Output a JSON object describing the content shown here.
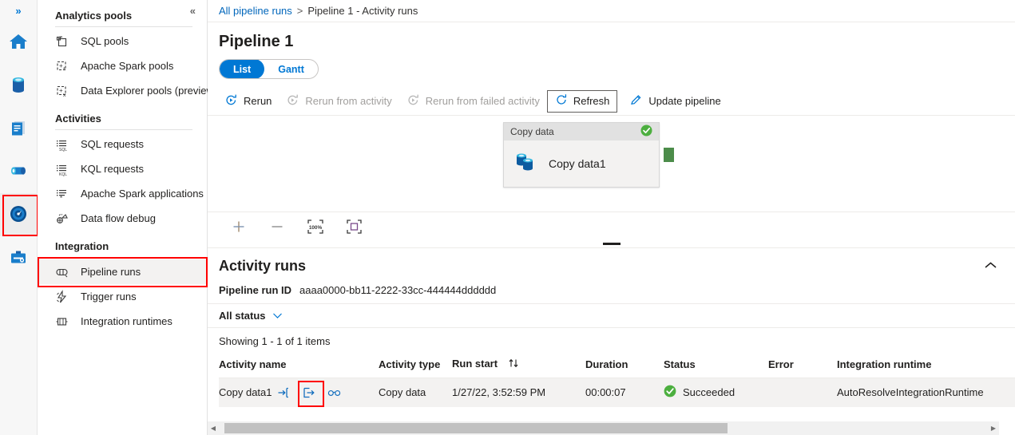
{
  "rail": {
    "expand_label": "»",
    "icons": [
      {
        "name": "home-icon",
        "title": "Home"
      },
      {
        "name": "data-icon",
        "title": "Data"
      },
      {
        "name": "develop-icon",
        "title": "Develop"
      },
      {
        "name": "integrate-icon",
        "title": "Integrate"
      },
      {
        "name": "monitor-icon",
        "title": "Monitor"
      },
      {
        "name": "manage-icon",
        "title": "Manage"
      }
    ]
  },
  "nav": {
    "collapse_label": "«",
    "sections": [
      {
        "title": "Analytics pools",
        "items": [
          {
            "label": "SQL pools",
            "icon": "sql-pools-icon"
          },
          {
            "label": "Apache Spark pools",
            "icon": "spark-pools-icon"
          },
          {
            "label": "Data Explorer pools (preview)",
            "icon": "data-explorer-pools-icon"
          }
        ]
      },
      {
        "title": "Activities",
        "items": [
          {
            "label": "SQL requests",
            "icon": "sql-requests-icon"
          },
          {
            "label": "KQL requests",
            "icon": "kql-requests-icon"
          },
          {
            "label": "Apache Spark applications",
            "icon": "spark-applications-icon"
          },
          {
            "label": "Data flow debug",
            "icon": "data-flow-debug-icon"
          }
        ]
      },
      {
        "title": "Integration",
        "items": [
          {
            "label": "Pipeline runs",
            "icon": "pipeline-runs-icon"
          },
          {
            "label": "Trigger runs",
            "icon": "trigger-runs-icon"
          },
          {
            "label": "Integration runtimes",
            "icon": "integration-runtimes-icon"
          }
        ]
      }
    ]
  },
  "breadcrumb": {
    "root": "All pipeline runs",
    "separator": ">",
    "current": "Pipeline 1 - Activity runs"
  },
  "page": {
    "title": "Pipeline 1"
  },
  "pivot": {
    "list": "List",
    "gantt": "Gantt",
    "selected": "List"
  },
  "toolbar": {
    "rerun": "Rerun",
    "rerun_from_activity": "Rerun from activity",
    "rerun_from_failed_activity": "Rerun from failed activity",
    "refresh": "Refresh",
    "update_pipeline": "Update pipeline"
  },
  "canvas": {
    "node": {
      "type_label": "Copy data",
      "name": "Copy data1",
      "status": "succeeded"
    },
    "tools": {
      "zoom_in": "+",
      "zoom_out": "−",
      "zoom_level": "100%",
      "fit_to_screen": "Fit to screen"
    }
  },
  "activity_runs": {
    "title": "Activity runs",
    "run_id_label": "Pipeline run ID",
    "run_id_value": "aaaa0000-bb11-2222-33cc-444444dddddd",
    "status_filter": "All status",
    "showing": "Showing 1 - 1 of 1 items",
    "columns": [
      "Activity name",
      "Activity type",
      "Run start",
      "Duration",
      "Status",
      "Error",
      "Integration runtime"
    ],
    "rows": [
      {
        "activity_name": "Copy data1",
        "activity_type": "Copy data",
        "run_start": "1/27/22, 3:52:59 PM",
        "duration": "00:00:07",
        "status": "Succeeded",
        "error": "",
        "integration_runtime": "AutoResolveIntegrationRuntime",
        "icons": [
          {
            "name": "input-icon",
            "highlighted": false
          },
          {
            "name": "output-icon",
            "highlighted": true
          },
          {
            "name": "details-glasses-icon",
            "highlighted": false
          }
        ]
      }
    ]
  },
  "colors": {
    "accent": "#0078d4",
    "link": "#0066bb",
    "success": "#107c10",
    "highlight": "#ff0000",
    "node_port": "#4c8c4a",
    "row_bg": "#f3f2f1"
  }
}
